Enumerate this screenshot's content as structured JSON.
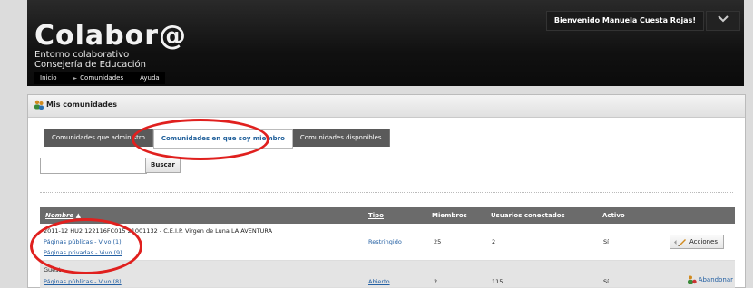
{
  "header": {
    "logo": "Colabor@",
    "subtitle_line1": "Entorno colaborativo",
    "subtitle_line2": "Consejería de Educación",
    "welcome": "Bienvenido Manuela Cuesta Rojas!",
    "welcome_icon": "chevron-down-icon"
  },
  "nav": {
    "items": [
      "Inicio",
      "Comunidades",
      "Ayuda"
    ]
  },
  "panel": {
    "title": "Mis comunidades",
    "tabs": [
      "Comunidades que administro",
      "Comunidades en que soy miembro",
      "Comunidades disponibles"
    ],
    "active_tab": 1
  },
  "search": {
    "placeholder": "",
    "button": "Buscar"
  },
  "table": {
    "headers": {
      "nombre": "Nombre",
      "sort_indicator": "▲",
      "tipo": "Tipo",
      "miembros": "Miembros",
      "usuarios": "Usuarios conectados",
      "activo": "Activo"
    },
    "rows": [
      {
        "name": "2011-12 HU2 122116FC015 21001132 - C.E.I.P. Virgen de Luna LA AVENTURA",
        "links": [
          "Páginas públicas - Vivo (1)",
          "Páginas privadas - Vivo (9)"
        ],
        "tipo": "Restringido",
        "miembros": "25",
        "usuarios": "2",
        "activo": "Sí",
        "action": "Acciones"
      },
      {
        "name": "Guest",
        "links": [
          "Páginas públicas - Vivo (8)"
        ],
        "tipo": "Abierto",
        "miembros": "2",
        "usuarios": "115",
        "activo": "Sí",
        "action": "Abandonar"
      }
    ]
  },
  "colors": {
    "accent_link": "#2460a3",
    "highlight_circle": "#e0201e",
    "header_bg": "#111111"
  }
}
